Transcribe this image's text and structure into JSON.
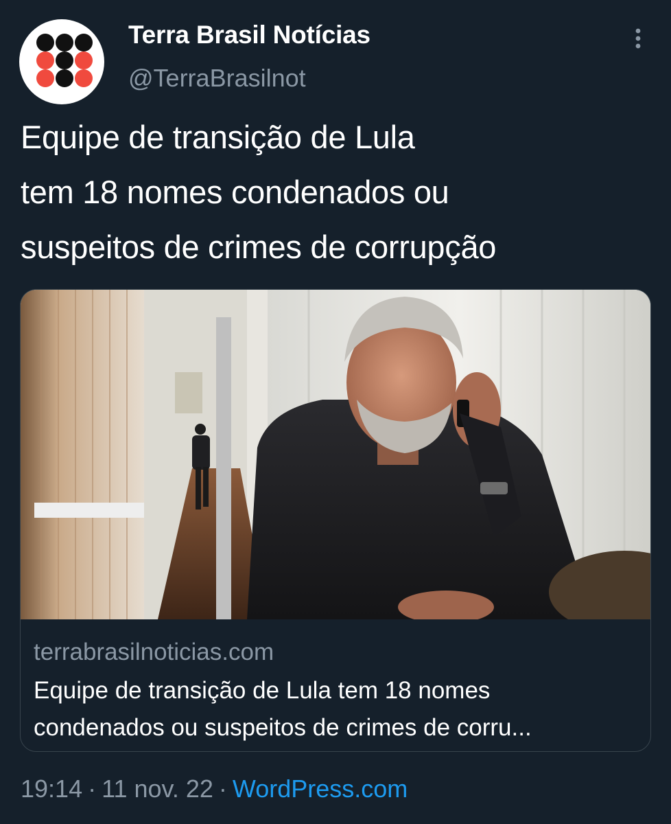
{
  "author": {
    "name": "Terra Brasil Notícias",
    "handle": "@TerraBrasilnot",
    "avatar_icon": "dot-grid-logo-icon",
    "avatar_colors": {
      "black": "#111111",
      "red": "#f04a3e",
      "bg": "#ffffff"
    }
  },
  "more_icon": "more-vertical-icon",
  "tweet": {
    "text_lines": [
      "Equipe de transição de Lula",
      "tem 18 nomes condenados ou",
      "suspeitos de crimes de corrupção"
    ]
  },
  "card": {
    "image_icon": "article-photo",
    "domain": "terrabrasilnoticias.com",
    "title_lines": [
      "Equipe de transição de Lula tem 18 nomes",
      "condenados ou suspeitos de crimes de corru..."
    ]
  },
  "meta": {
    "time": "19:14",
    "separator": "·",
    "date": "11 nov. 22",
    "source": "WordPress.com",
    "source_color": "#1d9bf0"
  },
  "theme": {
    "background": "#15202b",
    "secondary_text": "#8b98a5",
    "border": "#38444d"
  }
}
